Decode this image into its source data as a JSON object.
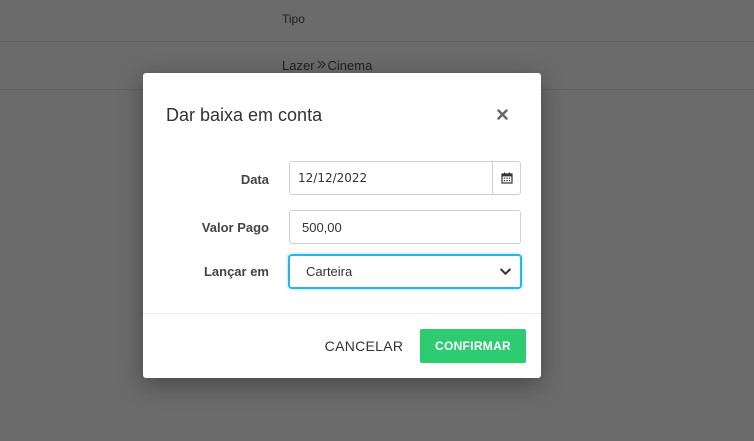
{
  "background": {
    "table": {
      "header_label": "Tipo",
      "row": {
        "category": "Lazer",
        "subcategory": "Cinema",
        "separator_icon": "double-chevron-right-icon"
      }
    }
  },
  "modal": {
    "title": "Dar baixa em conta",
    "close_icon": "close-icon",
    "fields": {
      "data": {
        "label": "Data",
        "value": "12/12/2022",
        "icon": "calendar-icon"
      },
      "valor_pago": {
        "label": "Valor Pago",
        "value": "500,00"
      },
      "lancar_em": {
        "label": "Lançar em",
        "selected": "Carteira",
        "icon": "chevron-down-icon"
      }
    },
    "buttons": {
      "cancel": "CANCELAR",
      "confirm": "CONFIRMAR"
    }
  },
  "colors": {
    "overlay": "#6b6b6b",
    "confirm_button": "#2ecc71",
    "focus_border": "#27b6e8"
  }
}
